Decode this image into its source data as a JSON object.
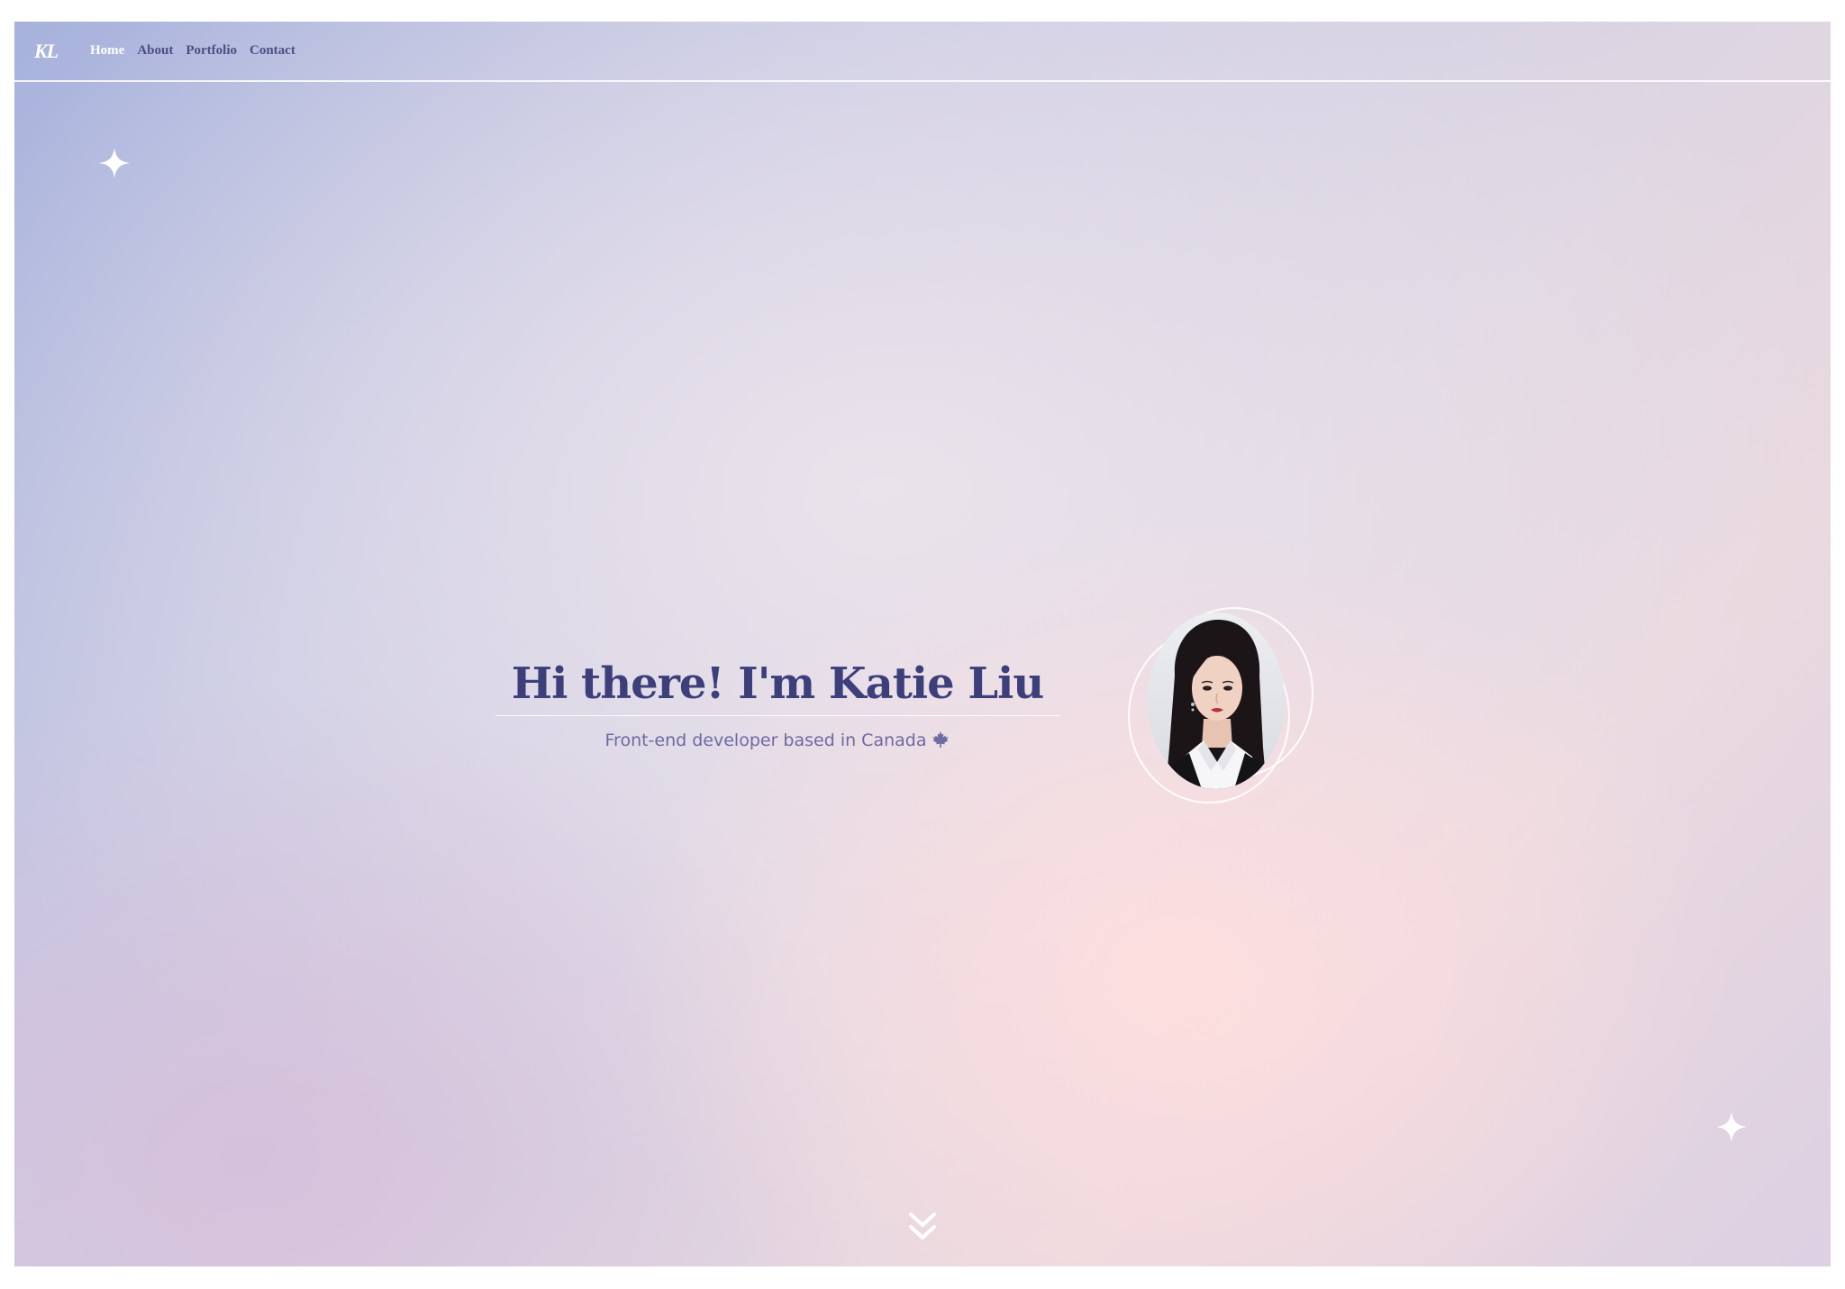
{
  "nav": {
    "logo": "KL",
    "links": [
      {
        "label": "Home",
        "active": true
      },
      {
        "label": "About",
        "active": false
      },
      {
        "label": "Portfolio",
        "active": false
      },
      {
        "label": "Contact",
        "active": false
      }
    ]
  },
  "hero": {
    "title": "Hi there! I'm Katie Liu",
    "subtitle": "Front-end developer based in Canada",
    "subtitle_icon": "maple-leaf-icon"
  },
  "icons": {
    "sparkle": "sparkle-icon",
    "scroll": "double-chevron-down-icon"
  },
  "colors": {
    "title": "#3c3f7a",
    "nav_link": "#4c4e85",
    "nav_active": "#ffffff",
    "subtitle": "#6e6aa2"
  }
}
